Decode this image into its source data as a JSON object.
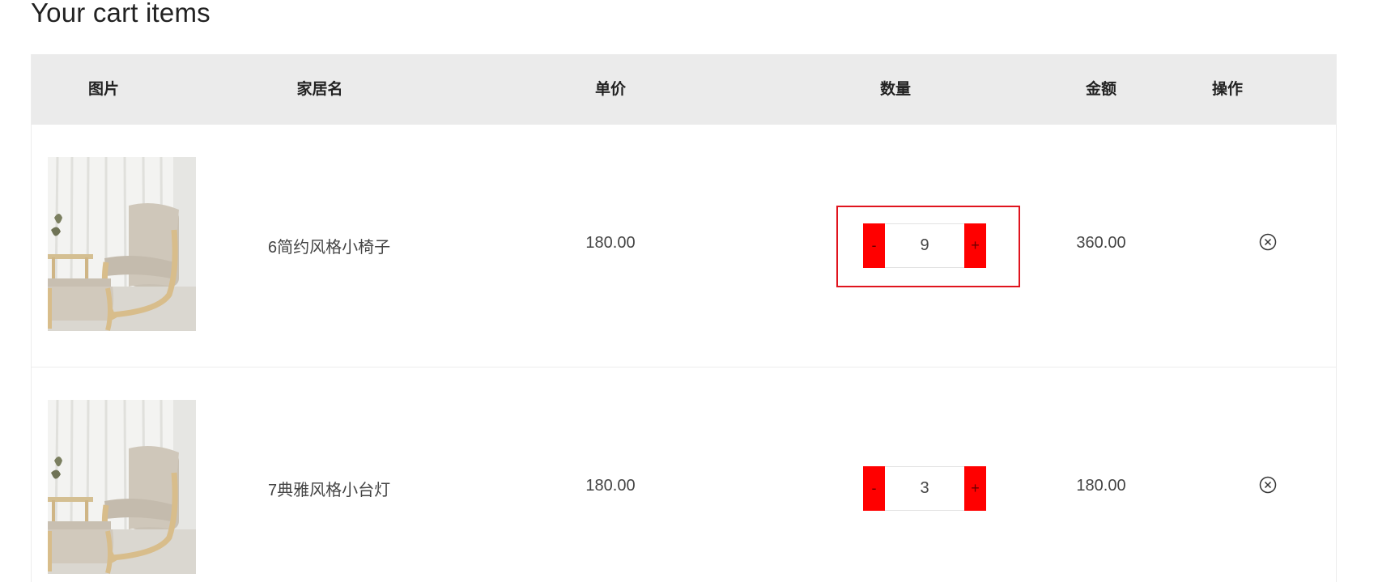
{
  "page": {
    "title": "Your cart items"
  },
  "table": {
    "headers": {
      "image": "图片",
      "name": "家居名",
      "price": "单价",
      "quantity": "数量",
      "amount": "金额",
      "action": "操作"
    },
    "rows": [
      {
        "name": "6简约风格小椅子",
        "price": "180.00",
        "quantity": "9",
        "amount": "360.00",
        "decrement_label": "-",
        "increment_label": "+",
        "highlighted": true
      },
      {
        "name": "7典雅风格小台灯",
        "price": "180.00",
        "quantity": "3",
        "amount": "180.00",
        "decrement_label": "-",
        "increment_label": "+",
        "highlighted": false
      }
    ]
  },
  "icons": {
    "remove": "close-circle-icon",
    "product": "armchair-product-image"
  },
  "colors": {
    "header_bg": "#ebebeb",
    "qty_button": "#ff0000",
    "highlight_border": "#e0141e"
  }
}
